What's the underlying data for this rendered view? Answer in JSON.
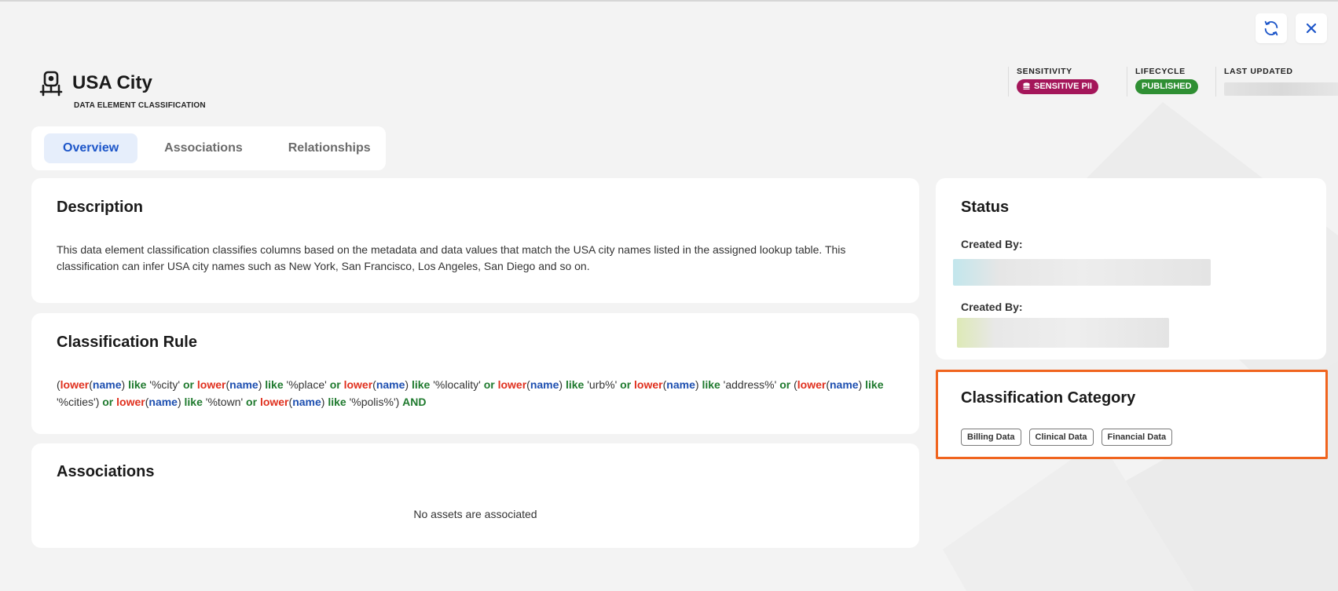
{
  "header": {
    "title": "USA City",
    "subtitle": "DATA ELEMENT CLASSIFICATION",
    "sensitivity_label": "SENSITIVITY",
    "sensitivity_value": "SENSITIVE PII",
    "lifecycle_label": "LIFECYCLE",
    "lifecycle_value": "PUBLISHED",
    "last_updated_label": "LAST UPDATED"
  },
  "tabs": [
    {
      "label": "Overview",
      "active": true
    },
    {
      "label": "Associations",
      "active": false
    },
    {
      "label": "Relationships",
      "active": false
    }
  ],
  "description": {
    "title": "Description",
    "text": "This data element classification classifies columns based on the metadata and data values that match the USA city names listed in the assigned lookup table. This classification can infer USA city names such as New York, San Francisco, Los Angeles, San Diego and so on."
  },
  "rule": {
    "title": "Classification Rule",
    "parts": [
      "(",
      "lower",
      "(",
      "name",
      ") ",
      "like",
      " '%city' ",
      "or",
      " ",
      "lower",
      "(",
      "name",
      ") ",
      "like",
      " '%place' ",
      "or",
      " ",
      "lower",
      "(",
      "name",
      ") ",
      "like",
      " '%locality' ",
      "or",
      " ",
      "lower",
      "(",
      "name",
      ") ",
      "like",
      " 'urb%' ",
      "or",
      " ",
      "lower",
      "(",
      "name",
      ") ",
      "like",
      " 'address%' ",
      "or",
      " (",
      "lower",
      "(",
      "name",
      ") ",
      "like",
      " '%cities') ",
      "or",
      " ",
      "lower",
      "(",
      "name",
      ") ",
      "like",
      " '%town' ",
      "or",
      " ",
      "lower",
      "(",
      "name",
      ") ",
      "like",
      " '%polis%') ",
      "AND"
    ]
  },
  "associations": {
    "title": "Associations",
    "empty_text": "No assets are associated"
  },
  "status": {
    "title": "Status",
    "created_by_label_1": "Created By:",
    "created_by_label_2": "Created By:"
  },
  "category": {
    "title": "Classification Category",
    "chips": [
      "Billing Data",
      "Clinical Data",
      "Financial Data"
    ]
  },
  "colors": {
    "accent": "#1d56c9",
    "pii": "#a4165a",
    "published": "#2f8f33",
    "highlight": "#f0641e",
    "function": "#e0301e",
    "column": "#1d4fb0",
    "keyword": "#1f7a2e"
  },
  "icons": {
    "refresh": "refresh-icon",
    "close": "close-icon",
    "entity": "data-element-classification-icon",
    "pii": "database-icon"
  }
}
